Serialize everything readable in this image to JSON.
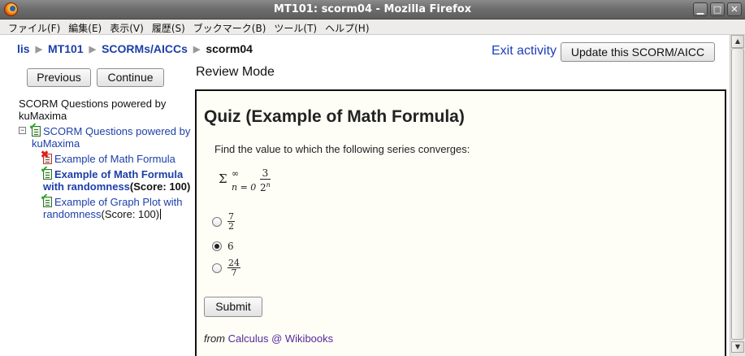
{
  "window": {
    "title": "MT101: scorm04 - Mozilla Firefox",
    "controls": [
      "minimize",
      "maximize",
      "close"
    ]
  },
  "menubar": {
    "items": [
      "ファイル(F)",
      "編集(E)",
      "表示(V)",
      "履歴(S)",
      "ブックマーク(B)",
      "ツール(T)",
      "ヘルプ(H)"
    ]
  },
  "breadcrumb": {
    "items": [
      "lis",
      "MT101",
      "SCORMs/AICCs"
    ],
    "current": "scorm04",
    "separator": "▶"
  },
  "header": {
    "exit_label": "Exit activity",
    "update_label": "Update this SCORM/AICC"
  },
  "nav": {
    "previous_label": "Previous",
    "continue_label": "Continue"
  },
  "review_mode_label": "Review Mode",
  "toc": {
    "header": "SCORM Questions powered by kuMaxima",
    "root_label": "SCORM Questions powered by kuMaxima",
    "items": [
      {
        "label": "Example of Math Formula",
        "score": "",
        "status": "failed"
      },
      {
        "label": "Example of Math Formula with randomness",
        "score": "(Score: 100)",
        "status": "passed",
        "current": true
      },
      {
        "label": "Example of Graph Plot with randomness",
        "score": "(Score: 100)",
        "status": "passed"
      }
    ]
  },
  "quiz": {
    "title": "Quiz (Example of Math Formula)",
    "question": "Find the value to which the following series converges:",
    "formula": {
      "sigma": "Σ",
      "upper": "∞",
      "lower": "n = 0",
      "numerator": "3",
      "denominator_base": "2",
      "denominator_exp": "n"
    },
    "options": [
      {
        "numerator": "7",
        "denominator": "2",
        "selected": false
      },
      {
        "value": "6",
        "selected": true
      },
      {
        "numerator": "24",
        "denominator": "7",
        "selected": false
      }
    ],
    "submit_label": "Submit",
    "source_prefix": "from",
    "source_link": "Calculus @ Wikibooks"
  },
  "colors": {
    "link": "#1c3fa8",
    "visited_link": "#552a99",
    "frame_background": "#fefef7",
    "passed": "#2aa52a",
    "failed": "#e0201a"
  }
}
